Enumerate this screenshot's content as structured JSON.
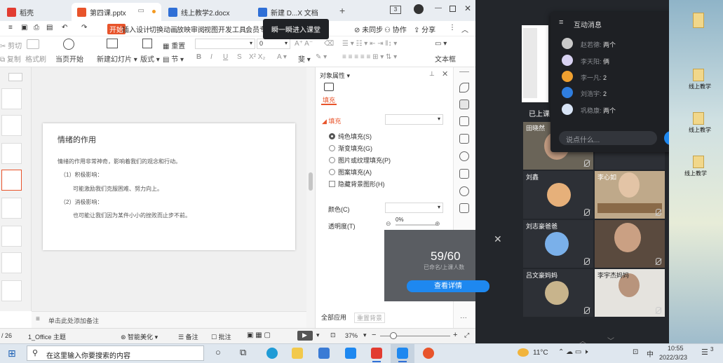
{
  "wps": {
    "tabs": [
      {
        "label": "稻壳",
        "color": "#e23c31"
      },
      {
        "label": "第四课.pptx",
        "color": "#e8542b"
      },
      {
        "label": "线上教学2.docx",
        "color": "#2f6fd6"
      },
      {
        "label": "新建 D...X 文档",
        "color": "#2f6fd6"
      }
    ],
    "tab_counter": "3",
    "menu": [
      "开始",
      "插入",
      "设计",
      "切换",
      "动画",
      "放映",
      "审阅",
      "视图",
      "开发工具",
      "会员专"
    ],
    "menu_right": [
      "未同步",
      "协作",
      "分享"
    ],
    "tooltip": "瞬一瞬进入课堂",
    "ribbon": {
      "cut": "剪切",
      "copy": "复制",
      "format_painter": "格式刷",
      "start_from_current": "当页开始",
      "new_slide": "新建幻灯片",
      "layout": "版式",
      "section": "节",
      "reset": "重置",
      "font_size": "0",
      "text_box": "文本框"
    },
    "slide": {
      "title": "情绪的作用",
      "line1": "情绪的作用非常神奇，影响着我们的观念和行动。",
      "item1_head": "（1）积极影响：",
      "item1_body": "可能激励我们克服困难、努力向上。",
      "item2_head": "（2）消极影响：",
      "item2_body": "也可能让我们因为某件小小的挫败而止步不前。"
    },
    "notes_placeholder": "单击此处添加备注",
    "panel": {
      "title": "对象属性",
      "tab_fill": "填充",
      "section_fill": "填充",
      "options": [
        "纯色填充(S)",
        "渐变填充(G)",
        "图片或纹理填充(P)",
        "图案填充(A)"
      ],
      "hide_bg": "隐藏背景图形(H)",
      "color_label": "颜色(C)",
      "transparency_label": "透明度(T)",
      "transparency_value": "0%",
      "apply_all": "全部应用",
      "reset_bg": "重置背景"
    },
    "status": {
      "page": "/ 26",
      "theme": "1_Office 主题",
      "beautify": "智能美化",
      "notes": "备注",
      "comments": "批注",
      "zoom": "37%"
    }
  },
  "classapp": {
    "status_label": "已上课",
    "students": [
      {
        "name": "田晓然"
      },
      {
        "name": "刘鑫"
      },
      {
        "name": "李心如"
      },
      {
        "name": "刘志豪爸爸"
      },
      {
        "name": "吕文豪妈妈"
      },
      {
        "name": "李宇杰妈妈"
      }
    ],
    "popup": {
      "count": "59/60",
      "sub": "已命名/上课人数",
      "button": "查看详情"
    }
  },
  "messages": {
    "title": "互动消息",
    "rows": [
      {
        "name": "赵若德:",
        "text": "两个",
        "color": "#c9c9c9"
      },
      {
        "name": "李天阳:",
        "text": "俩",
        "color": "#d8d2f2"
      },
      {
        "name": "李一凡:",
        "text": "2",
        "color": "#f0a030"
      },
      {
        "name": "刘浩宇:",
        "text": "2",
        "color": "#2f7ee0"
      },
      {
        "name": "巩稳康:",
        "text": "两个",
        "color": "#d8e4f6"
      }
    ],
    "input_placeholder": "说点什么...",
    "send": "发送"
  },
  "desktop": {
    "icons": [
      {
        "label": "线上教学"
      },
      {
        "label": "线上教学"
      },
      {
        "label": "线上教学"
      }
    ]
  },
  "taskbar": {
    "search_placeholder": "在这里输入你要搜索的内容",
    "weather": "11°C",
    "ime": "中",
    "time": "10:55",
    "date": "2022/3/23",
    "notification_count": "3"
  }
}
